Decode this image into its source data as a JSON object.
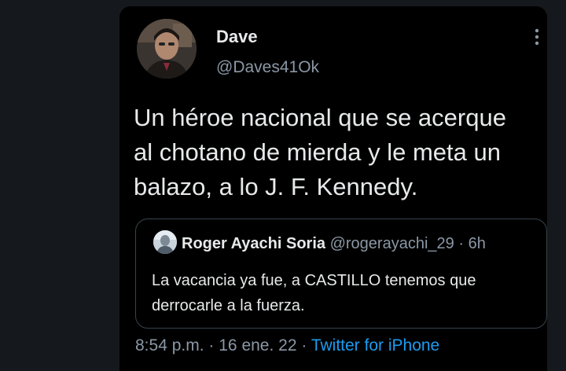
{
  "tweet": {
    "author": {
      "display_name": "Dave",
      "handle": "@Daves41Ok",
      "avatar": "profile-photo-icon"
    },
    "more_icon": "more-vertical-icon",
    "text_lines": [
      "Un héroe nacional que se acerque",
      "al chotano de mierda y le meta un",
      "balazo, a lo J. F. Kennedy."
    ],
    "quoted": {
      "avatar": "profile-photo-icon",
      "display_name": "Roger Ayachi Soria",
      "handle": "@rogerayachi_29",
      "separator": "·",
      "time": "6h",
      "text_lines": [
        "La vacancia ya fue, a CASTILLO tenemos que",
        "derrocarle a la fuerza."
      ]
    },
    "meta": {
      "time": "8:54 p.m.",
      "separator1": "·",
      "date": "16 ene. 22",
      "separator2": "·",
      "source": "Twitter for iPhone"
    }
  },
  "colors": {
    "background": "#15181c",
    "card": "#000000",
    "primary_text": "#e7e9ea",
    "secondary_text": "#8b98a5",
    "link": "#1d9bf0",
    "border": "#38444d"
  }
}
